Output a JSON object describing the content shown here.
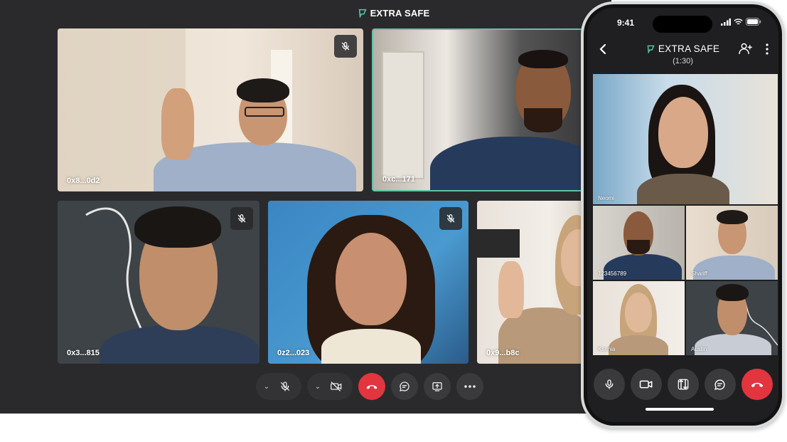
{
  "desktop": {
    "title": "EXTRA SAFE",
    "tiles": [
      {
        "label": "0x8...0d2",
        "muted": true
      },
      {
        "label": "0xc...171",
        "muted": false,
        "active": true
      },
      {
        "label": "0x3...815",
        "muted": true
      },
      {
        "label": "0z2...023",
        "muted": true
      },
      {
        "label": "0x9...b8c",
        "muted": false
      }
    ],
    "toolbar": {
      "buttons": [
        "mic-off",
        "camera-off",
        "end-call",
        "chat",
        "share-screen",
        "more"
      ]
    }
  },
  "phone": {
    "status_time": "9:41",
    "title": "EXTRA SAFE",
    "subtitle": "(1:30)",
    "tiles": [
      {
        "label": "Neomi"
      },
      {
        "label": "123456789"
      },
      {
        "label": "Shariff"
      },
      {
        "label": "Ksenia"
      },
      {
        "label": "Austin"
      }
    ],
    "controls": [
      "mic",
      "video",
      "flip-camera",
      "chat",
      "end-call"
    ]
  },
  "colors": {
    "accent": "#5fc2a6",
    "end_call": "#e2353f",
    "window_bg": "#2a2a2c"
  }
}
